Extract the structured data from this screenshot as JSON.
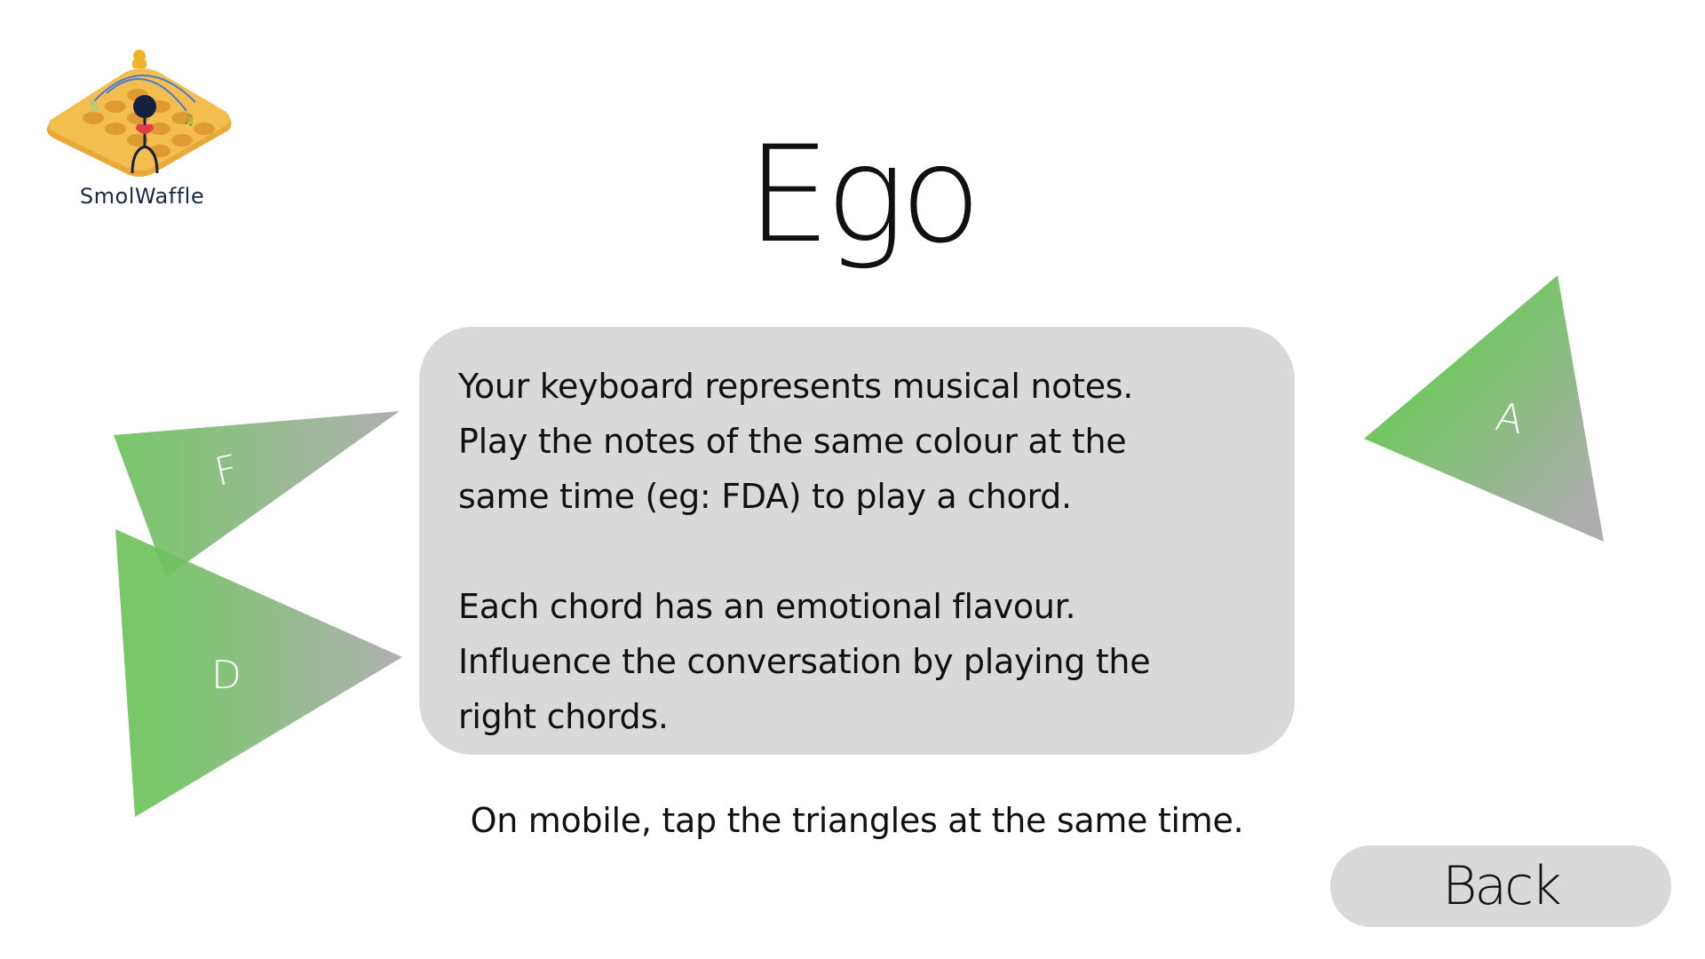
{
  "logo": {
    "text": "SmolWaffle",
    "icon": "waffle-logo-icon"
  },
  "title": "Ego",
  "panel": {
    "lines": [
      "Your keyboard represents musical notes.",
      "Play the notes of the same colour at the",
      "same time (eg: FDA) to play a chord.",
      "",
      "Each chord has an emotional flavour.",
      "Influence the conversation by playing the",
      "right chords."
    ]
  },
  "mobile_hint": "On mobile, tap the triangles at the same time.",
  "back_button": {
    "label": "Back"
  },
  "triangles": [
    {
      "note": "F",
      "color_start": "#6cc35c",
      "color_end": "#a9a9a9"
    },
    {
      "note": "D",
      "color_start": "#6cc35c",
      "color_end": "#a9a9a9"
    },
    {
      "note": "A",
      "color_start": "#6cc35c",
      "color_end": "#a9a9a9"
    }
  ],
  "colors": {
    "background": "#ffffff",
    "panel": "#d9d9d9",
    "text": "#111111",
    "logo_text": "#1b2a44"
  }
}
